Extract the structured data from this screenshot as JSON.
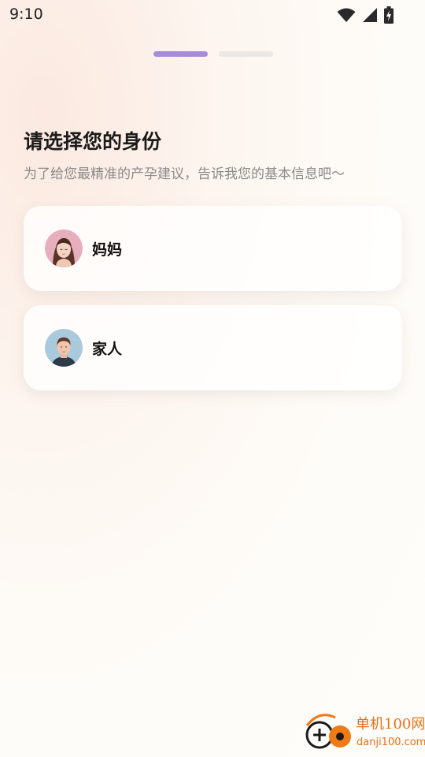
{
  "status_bar": {
    "time": "9:10",
    "icons": [
      "wifi-icon",
      "cellular-signal-icon",
      "battery-charging-icon"
    ]
  },
  "progress": {
    "total_steps": 2,
    "current_step": 1,
    "active_color": "#a78bd8",
    "inactive_color": "#ebe7e4"
  },
  "page": {
    "title": "请选择您的身份",
    "subtitle": "为了给您最精准的产孕建议，告诉我您的基本信息吧～"
  },
  "options": [
    {
      "label": "妈妈",
      "avatar": "woman-avatar-icon"
    },
    {
      "label": "家人",
      "avatar": "man-avatar-icon"
    }
  ],
  "watermark": {
    "brand": "单机100网",
    "url": "danji100.com",
    "color": "#e8701a"
  }
}
